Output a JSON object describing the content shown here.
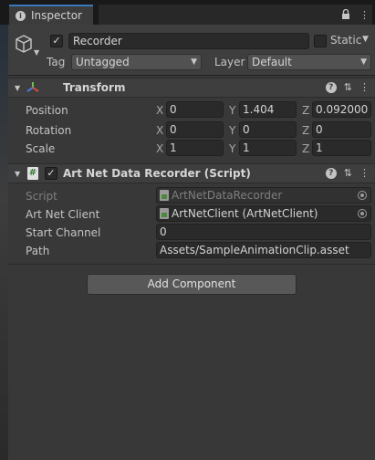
{
  "tab": {
    "title": "Inspector",
    "icons": [
      "lock-icon",
      "more-icon"
    ]
  },
  "gameobject": {
    "active": true,
    "name": "Recorder",
    "static_label": "Static",
    "static_checked": false,
    "tag_label": "Tag",
    "tag_value": "Untagged",
    "layer_label": "Layer",
    "layer_value": "Default"
  },
  "transform": {
    "title": "Transform",
    "rows": [
      {
        "label": "Position",
        "x": "0",
        "y": "1.404",
        "z": "0.092000"
      },
      {
        "label": "Rotation",
        "x": "0",
        "y": "0",
        "z": "0"
      },
      {
        "label": "Scale",
        "x": "1",
        "y": "1",
        "z": "1"
      }
    ],
    "axis": {
      "x": "X",
      "y": "Y",
      "z": "Z"
    }
  },
  "recorder": {
    "title": "Art Net Data Recorder (Script)",
    "enabled": true,
    "script_label": "Script",
    "script_value": "ArtNetDataRecorder",
    "client_label": "Art Net Client",
    "client_value": "ArtNetClient (ArtNetClient)",
    "channel_label": "Start Channel",
    "channel_value": "0",
    "path_label": "Path",
    "path_value": "Assets/SampleAnimationClip.asset"
  },
  "add_component_label": "Add Component",
  "colors": {
    "accent": "#3a79bb",
    "panel": "#383838",
    "field": "#2a2a2a"
  }
}
